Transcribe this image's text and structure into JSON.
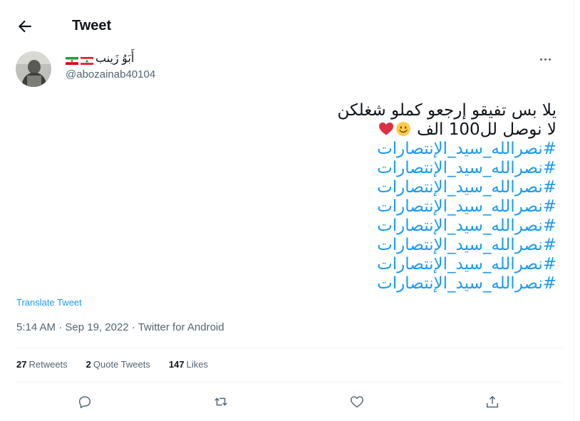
{
  "header": {
    "title": "Tweet",
    "back_icon": "arrow-left-icon"
  },
  "author": {
    "display_name": "أَبَوُ زَينب",
    "handle": "@abozainab40104",
    "flags": [
      "iran-flag-icon",
      "lebanon-flag-icon"
    ]
  },
  "tweet": {
    "line1": "يلا بس تفيقو إرجعو كملو شغلكن",
    "line2": "لا نوصل لل100 الف",
    "emojis": [
      "smiling-face-emoji",
      "red-heart-emoji"
    ],
    "hashtags": [
      "#نصرالله_سيد_الإنتصارات",
      "#نصرالله_سيد_الإنتصارات",
      "#نصرالله_سيد_الإنتصارات",
      "#نصرالله_سيد_الإنتصارات",
      "#نصرالله_سيد_الإنتصارات",
      "#نصرالله_سيد_الإنتصارات",
      "#نصرالله_سيد_الإنتصارات",
      "#نصرالله_سيد_الإنتصارات"
    ]
  },
  "translate_label": "Translate Tweet",
  "meta": {
    "time": "5:14 AM",
    "separator": "·",
    "date": "Sep 19, 2022",
    "source": "Twitter for Android"
  },
  "stats": {
    "retweets": {
      "count": "27",
      "label": "Retweets"
    },
    "quotes": {
      "count": "2",
      "label": "Quote Tweets"
    },
    "likes": {
      "count": "147",
      "label": "Likes"
    }
  },
  "actions": [
    "reply-icon",
    "retweet-icon",
    "like-icon",
    "share-icon"
  ],
  "colors": {
    "accent": "#1d9bf0",
    "secondary_text": "#536471",
    "divider": "#eff3f4",
    "text": "#0f1419"
  }
}
